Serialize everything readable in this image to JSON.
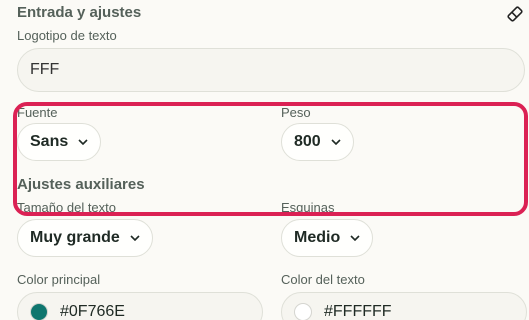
{
  "section": {
    "title": "Entrada y ajustes",
    "reset_icon": "eraser-icon"
  },
  "logo_text": {
    "label": "Logotipo de texto",
    "value": "FFF"
  },
  "font": {
    "label": "Fuente",
    "value": "Sans"
  },
  "weight": {
    "label": "Peso",
    "value": "800"
  },
  "aux": {
    "title": "Ajustes auxiliares"
  },
  "text_size": {
    "label": "Tamaño del texto",
    "value": "Muy grande"
  },
  "corners": {
    "label": "Esquinas",
    "value": "Medio"
  },
  "primary_color": {
    "label": "Color principal",
    "value": "#0F766E",
    "swatch": "#0f766e"
  },
  "text_color": {
    "label": "Color del texto",
    "value": "#FFFFFF",
    "swatch": "#ffffff"
  },
  "colors": {
    "highlight": "#db2154"
  }
}
